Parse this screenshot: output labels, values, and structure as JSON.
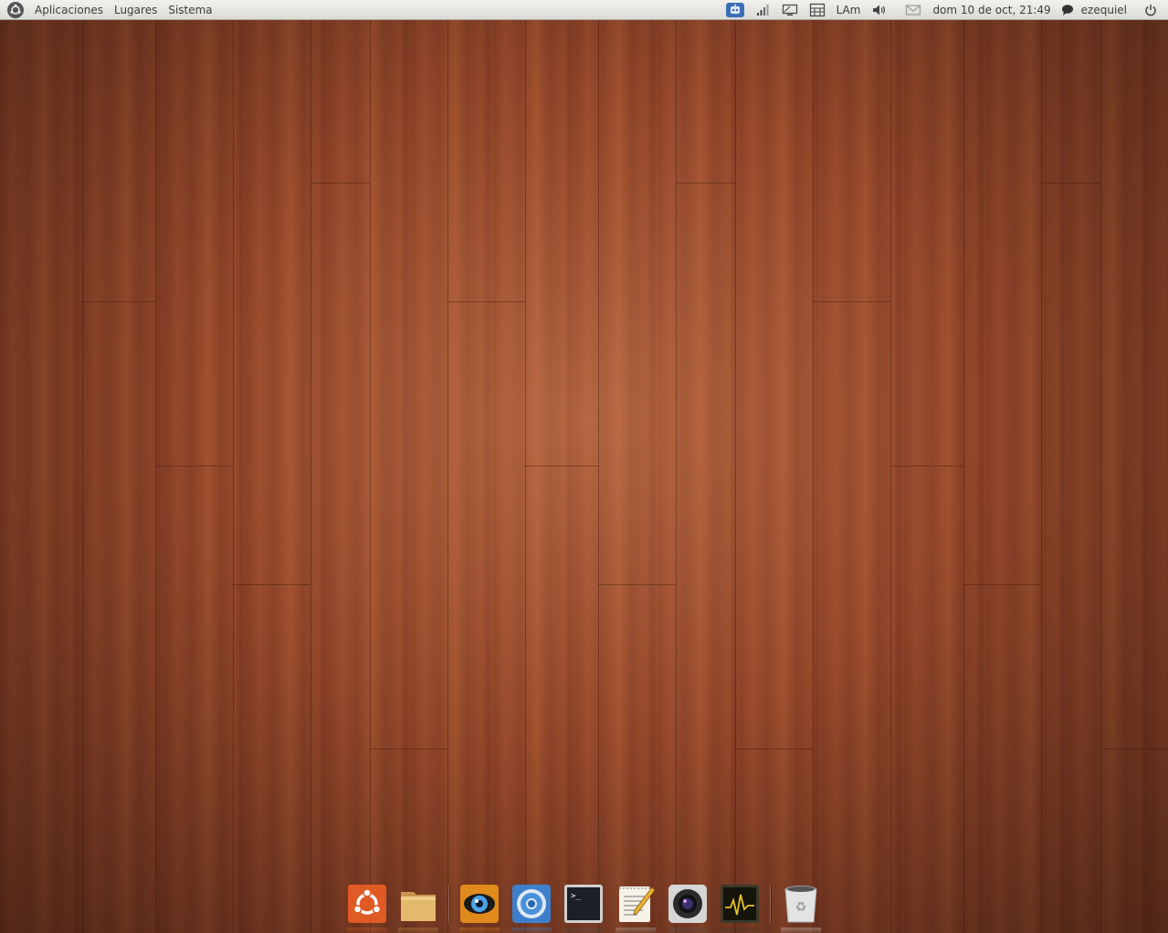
{
  "top_panel": {
    "menus": [
      "Aplicaciones",
      "Lugares",
      "Sistema"
    ],
    "keyboard_layout": "LAm",
    "clock": "dom 10 de oct, 21:49",
    "user": "ezequiel",
    "tray_icons": [
      "robot-icon",
      "signal-icon",
      "display-icon",
      "keyboard-icon",
      "volume-icon",
      "mail-icon",
      "chat-icon",
      "power-icon"
    ]
  },
  "dock": {
    "items": [
      "ubuntu-launcher",
      "files",
      "eye-app",
      "web-browser",
      "terminal",
      "text-editor",
      "camera-app",
      "system-monitor",
      "trash"
    ]
  },
  "colors": {
    "panel_bg": "#dcdad5",
    "wood": "#8a4226",
    "ubuntu_orange": "#e05a25"
  }
}
